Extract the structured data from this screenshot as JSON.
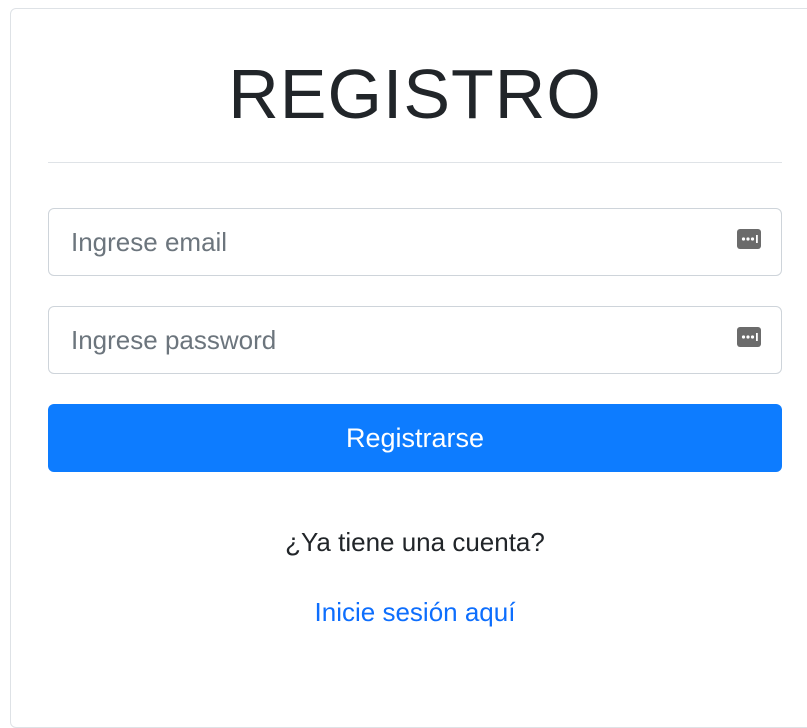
{
  "form": {
    "title": "REGISTRO",
    "email": {
      "placeholder": "Ingrese email",
      "value": "",
      "icon": "password-manager-icon"
    },
    "password": {
      "placeholder": "Ingrese password",
      "value": "",
      "icon": "password-manager-icon"
    },
    "submit_label": "Registrarse",
    "account_prompt": "¿Ya tiene una cuenta?",
    "login_link_label": "Inicie sesión aquí"
  },
  "colors": {
    "primary": "#0d7cff",
    "link": "#0d6efd",
    "text": "#212529",
    "border": "#ced4da"
  }
}
